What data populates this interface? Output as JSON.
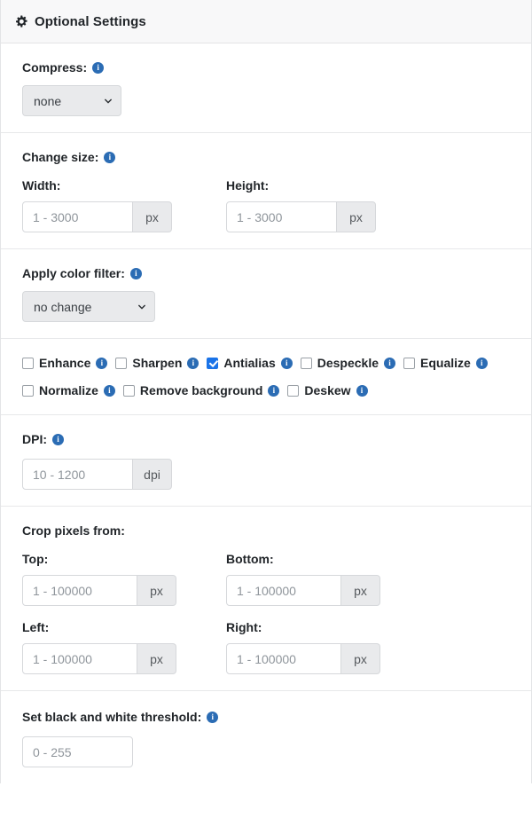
{
  "header": {
    "icon": "gear-icon",
    "title": "Optional Settings"
  },
  "colors": {
    "accent_info": "#2b6cb4",
    "checkbox_checked": "#1a73e8",
    "header_bg": "#f8f8f9",
    "border": "#e3e4e6",
    "input_border": "#d6d8db",
    "suffix_bg": "#e9eaec",
    "placeholder": "#8f959b"
  },
  "sections": {
    "compress": {
      "label": "Compress:",
      "info_icon": "info-icon",
      "selected": "none",
      "options": [
        "none"
      ],
      "chevron": "chevron-down-icon"
    },
    "change_size": {
      "label": "Change size:",
      "info_icon": "info-icon",
      "width": {
        "label": "Width:",
        "value": "",
        "placeholder": "1 - 3000",
        "suffix": "px"
      },
      "height": {
        "label": "Height:",
        "value": "",
        "placeholder": "1 - 3000",
        "suffix": "px"
      }
    },
    "color_filter": {
      "label": "Apply color filter:",
      "info_icon": "info-icon",
      "selected": "no change",
      "options": [
        "no change"
      ],
      "chevron": "chevron-down-icon"
    },
    "toggles": {
      "row1": [
        {
          "label": "Enhance",
          "checked": false
        },
        {
          "label": "Sharpen",
          "checked": false
        },
        {
          "label": "Antialias",
          "checked": true
        },
        {
          "label": "Despeckle",
          "checked": false
        },
        {
          "label": "Equalize",
          "checked": false
        }
      ],
      "row2": [
        {
          "label": "Normalize",
          "checked": false
        },
        {
          "label": "Remove background",
          "checked": false
        },
        {
          "label": "Deskew",
          "checked": false
        }
      ]
    },
    "dpi": {
      "label": "DPI:",
      "info_icon": "info-icon",
      "value": "",
      "placeholder": "10 - 1200",
      "suffix": "dpi"
    },
    "crop": {
      "title": "Crop pixels from:",
      "top": {
        "label": "Top:",
        "value": "",
        "placeholder": "1 - 100000",
        "suffix": "px"
      },
      "bottom": {
        "label": "Bottom:",
        "value": "",
        "placeholder": "1 - 100000",
        "suffix": "px"
      },
      "left": {
        "label": "Left:",
        "value": "",
        "placeholder": "1 - 100000",
        "suffix": "px"
      },
      "right": {
        "label": "Right:",
        "value": "",
        "placeholder": "1 - 100000",
        "suffix": "px"
      }
    },
    "threshold": {
      "label": "Set black and white threshold:",
      "info_icon": "info-icon",
      "value": "",
      "placeholder": "0 - 255"
    }
  }
}
